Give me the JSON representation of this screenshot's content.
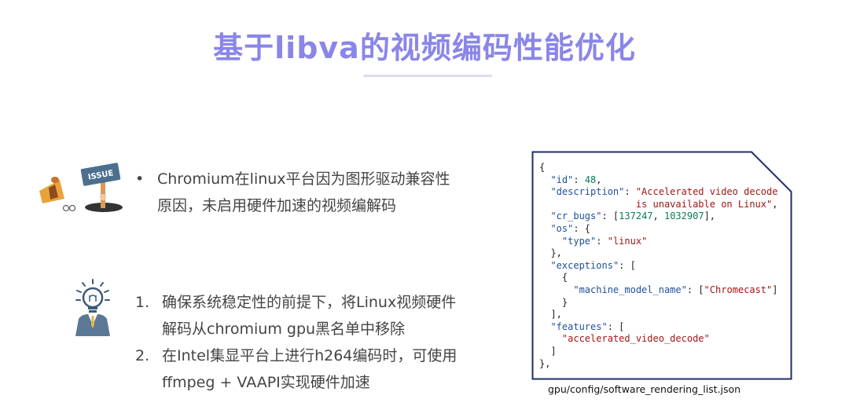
{
  "title": "基于libva的视频编码性能优化",
  "issue_icon_text": "ISSUE",
  "bullet": {
    "marker": "•",
    "line1": "Chromium在linux平台因为图形驱动兼容性",
    "line2": "原因，未启用硬件加速的视频编解码"
  },
  "steps": [
    {
      "num": "1.",
      "line1": "确保系统稳定性的前提下，将Linux视频硬件",
      "line2": "解码从chromium gpu黑名单中移除"
    },
    {
      "num": "2.",
      "line1": "在Intel集显平台上进行h264编码时，可使用",
      "line2": "ffmpeg + VAAPI实现硬件加速"
    }
  ],
  "code": {
    "open": "{",
    "id_key": "\"id\"",
    "id_val": "48",
    "desc_key": "\"description\"",
    "desc_val1": "\"Accelerated video decode",
    "desc_val2": "is unavailable on Linux\"",
    "bugs_key": "\"cr_bugs\"",
    "bug1": "137247",
    "bug2": "1032907",
    "os_key": "\"os\"",
    "type_key": "\"type\"",
    "type_val": "\"linux\"",
    "exc_key": "\"exceptions\"",
    "model_key": "\"machine_model_name\"",
    "model_val": "\"Chromecast\"",
    "feat_key": "\"features\"",
    "feat_val": "\"accelerated_video_decode\"",
    "close": "},"
  },
  "caption": "gpu/config/software_rendering_list.json",
  "colors": {
    "title": "#8a86e8",
    "frame": "#1f2d6b",
    "json_key": "#1f4f9c",
    "json_string": "#a31515",
    "json_number": "#0a7a5a"
  }
}
